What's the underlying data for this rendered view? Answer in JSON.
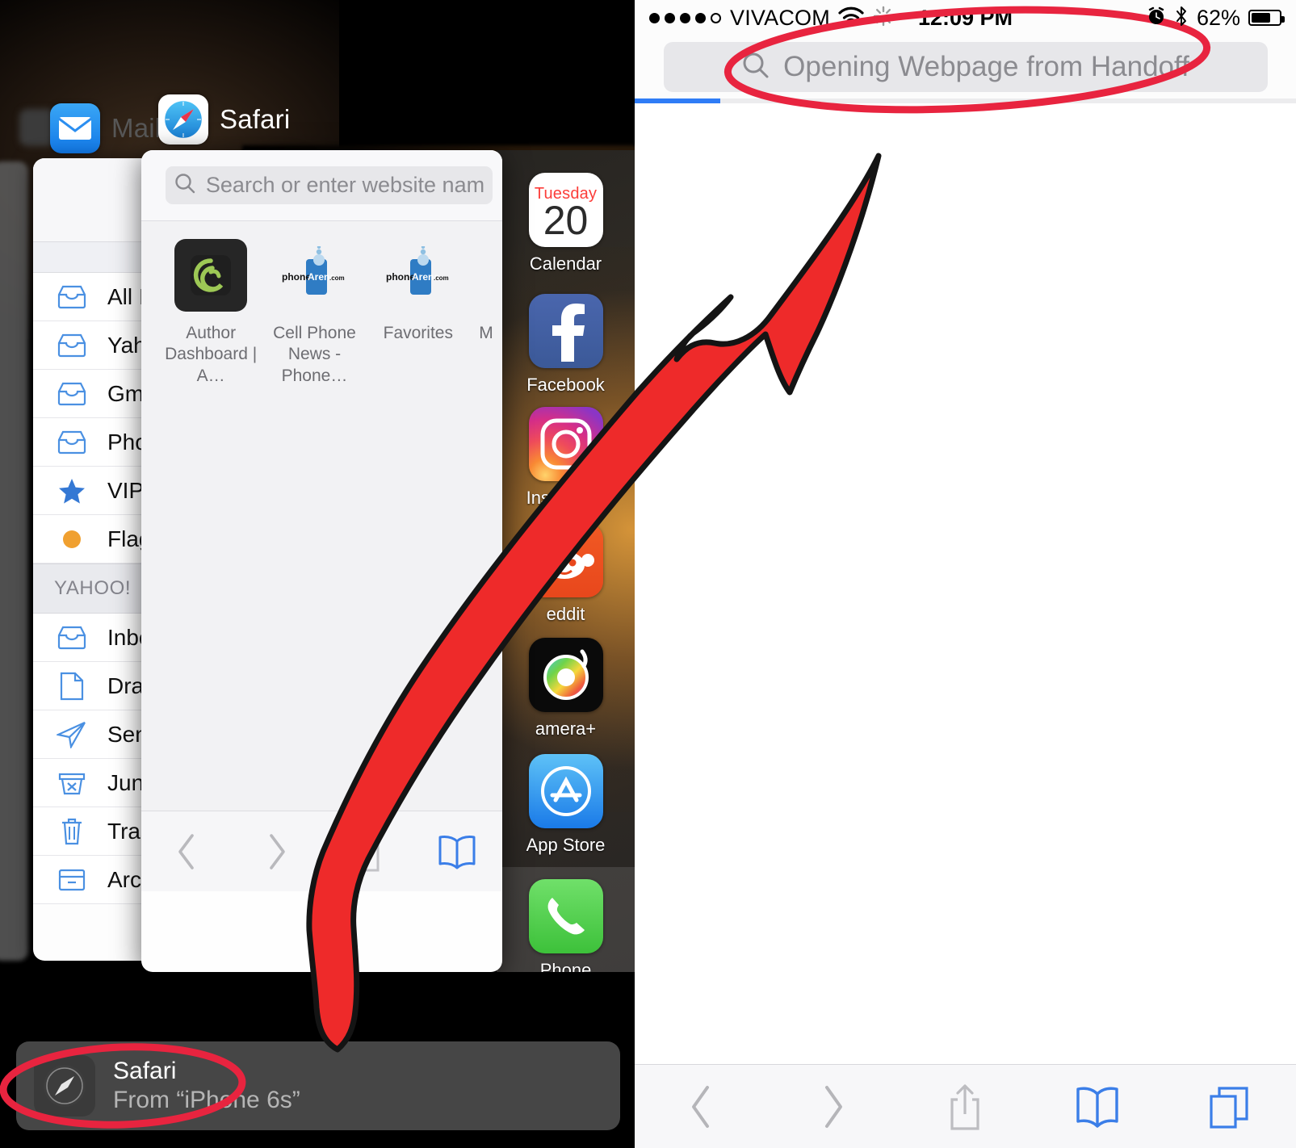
{
  "left_panel": {
    "app_switcher": {
      "apps": [
        {
          "title": "Mail",
          "icon": "mail-icon"
        },
        {
          "title": "Safari",
          "icon": "safari-icon"
        }
      ]
    },
    "mail_card": {
      "rows": [
        {
          "label": "All Inb",
          "icon": "inbox-icon"
        },
        {
          "label": "Yahoo",
          "icon": "inbox-icon"
        },
        {
          "label": "Gmail",
          "icon": "inbox-icon"
        },
        {
          "label": "Phone",
          "icon": "inbox-icon"
        },
        {
          "label": "VIP",
          "icon": "star-icon"
        },
        {
          "label": "Flagg",
          "icon": "flag-dot-icon"
        }
      ],
      "section_header": "YAHOO!",
      "section_rows": [
        {
          "label": "Inbox",
          "icon": "inbox-icon"
        },
        {
          "label": "Drafts",
          "icon": "draft-icon"
        },
        {
          "label": "Sent",
          "icon": "sent-icon"
        },
        {
          "label": "Junk",
          "icon": "junk-icon"
        },
        {
          "label": "Trash",
          "icon": "trash-icon"
        },
        {
          "label": "Archiv",
          "icon": "archive-icon"
        }
      ]
    },
    "safari_card": {
      "search_placeholder": "Search or enter website nam",
      "favorites": [
        {
          "caption": "Author\nDashboard | A…",
          "icon": "ghost-logo-icon"
        },
        {
          "caption": "Cell Phone\nNews - Phone…",
          "icon": "phonearena-icon"
        },
        {
          "caption": "Favorites",
          "icon": "phonearena-icon"
        },
        {
          "caption": "M",
          "icon": "partial-icon"
        }
      ],
      "toolbar": [
        {
          "name": "back",
          "icon": "chevron-left-icon",
          "enabled": false
        },
        {
          "name": "forward",
          "icon": "chevron-right-icon",
          "enabled": false
        },
        {
          "name": "share",
          "icon": "share-icon",
          "enabled": false
        },
        {
          "name": "bookmarks",
          "icon": "book-icon",
          "enabled": true
        }
      ]
    },
    "home_screen": {
      "apps": [
        {
          "name": "Calendar",
          "icon": "calendar-icon",
          "day_of_week": "Tuesday",
          "day_number": "20"
        },
        {
          "name": "Facebook",
          "icon": "facebook-icon"
        },
        {
          "name": "Instagram",
          "icon": "instagram-icon"
        },
        {
          "name": "eddit",
          "icon": "reddit-icon"
        },
        {
          "name": "amera+",
          "icon": "camera-plus-icon"
        },
        {
          "name": "App Store",
          "icon": "app-store-icon"
        }
      ],
      "dock": [
        {
          "name": "Phone",
          "icon": "phone-icon"
        }
      ]
    },
    "handoff_banner": {
      "app": "Safari",
      "source": "From “iPhone 6s”",
      "icon": "safari-compass-icon"
    }
  },
  "right_panel": {
    "status_bar": {
      "signal_dots_filled": 4,
      "signal_dots_total": 5,
      "carrier": "VIVACOM",
      "wifi": "wifi-icon",
      "activity": "spinner-icon",
      "time": "12:09 PM",
      "alarm": "alarm-icon",
      "bluetooth": "bluetooth-icon",
      "battery_percent": "62%",
      "battery_level": 62
    },
    "url_bar": {
      "placeholder": "Opening Webpage from Handoff",
      "search_icon": "search-icon"
    },
    "progress_percent": 13,
    "toolbar": [
      {
        "name": "back",
        "icon": "chevron-left-icon",
        "enabled": false
      },
      {
        "name": "forward",
        "icon": "chevron-right-icon",
        "enabled": false
      },
      {
        "name": "share",
        "icon": "share-icon",
        "enabled": false
      },
      {
        "name": "bookmarks",
        "icon": "book-icon",
        "enabled": true
      },
      {
        "name": "tabs",
        "icon": "tabs-icon",
        "enabled": true
      }
    ]
  },
  "annotations": {
    "accent_color": "#e8243f",
    "arrow_fill": "#ee2a2a",
    "arrow_stroke": "#141414",
    "ellipse_url_bar": "highlight-url-bar",
    "ellipse_handoff": "highlight-handoff-banner",
    "arrow": "arrow-handoff-to-urlbar"
  }
}
